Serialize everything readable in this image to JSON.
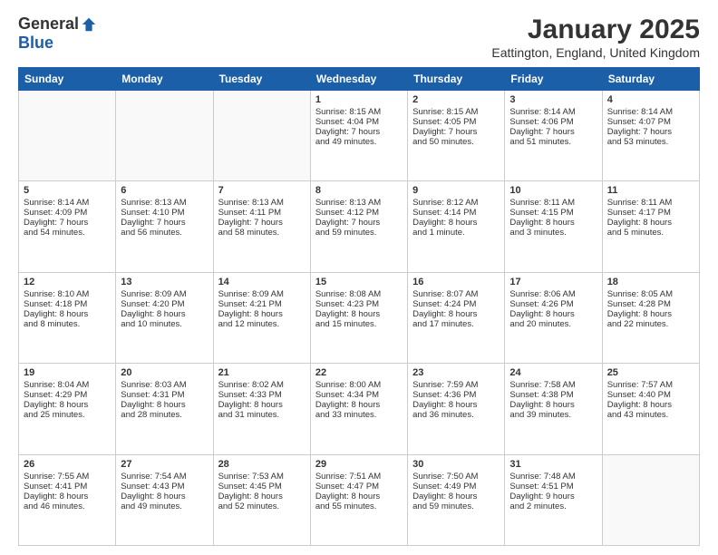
{
  "logo": {
    "general": "General",
    "blue": "Blue"
  },
  "title": "January 2025",
  "subtitle": "Eattington, England, United Kingdom",
  "days": [
    "Sunday",
    "Monday",
    "Tuesday",
    "Wednesday",
    "Thursday",
    "Friday",
    "Saturday"
  ],
  "weeks": [
    [
      {
        "day": "",
        "content": ""
      },
      {
        "day": "",
        "content": ""
      },
      {
        "day": "",
        "content": ""
      },
      {
        "day": "1",
        "content": "Sunrise: 8:15 AM\nSunset: 4:04 PM\nDaylight: 7 hours\nand 49 minutes."
      },
      {
        "day": "2",
        "content": "Sunrise: 8:15 AM\nSunset: 4:05 PM\nDaylight: 7 hours\nand 50 minutes."
      },
      {
        "day": "3",
        "content": "Sunrise: 8:14 AM\nSunset: 4:06 PM\nDaylight: 7 hours\nand 51 minutes."
      },
      {
        "day": "4",
        "content": "Sunrise: 8:14 AM\nSunset: 4:07 PM\nDaylight: 7 hours\nand 53 minutes."
      }
    ],
    [
      {
        "day": "5",
        "content": "Sunrise: 8:14 AM\nSunset: 4:09 PM\nDaylight: 7 hours\nand 54 minutes."
      },
      {
        "day": "6",
        "content": "Sunrise: 8:13 AM\nSunset: 4:10 PM\nDaylight: 7 hours\nand 56 minutes."
      },
      {
        "day": "7",
        "content": "Sunrise: 8:13 AM\nSunset: 4:11 PM\nDaylight: 7 hours\nand 58 minutes."
      },
      {
        "day": "8",
        "content": "Sunrise: 8:13 AM\nSunset: 4:12 PM\nDaylight: 7 hours\nand 59 minutes."
      },
      {
        "day": "9",
        "content": "Sunrise: 8:12 AM\nSunset: 4:14 PM\nDaylight: 8 hours\nand 1 minute."
      },
      {
        "day": "10",
        "content": "Sunrise: 8:11 AM\nSunset: 4:15 PM\nDaylight: 8 hours\nand 3 minutes."
      },
      {
        "day": "11",
        "content": "Sunrise: 8:11 AM\nSunset: 4:17 PM\nDaylight: 8 hours\nand 5 minutes."
      }
    ],
    [
      {
        "day": "12",
        "content": "Sunrise: 8:10 AM\nSunset: 4:18 PM\nDaylight: 8 hours\nand 8 minutes."
      },
      {
        "day": "13",
        "content": "Sunrise: 8:09 AM\nSunset: 4:20 PM\nDaylight: 8 hours\nand 10 minutes."
      },
      {
        "day": "14",
        "content": "Sunrise: 8:09 AM\nSunset: 4:21 PM\nDaylight: 8 hours\nand 12 minutes."
      },
      {
        "day": "15",
        "content": "Sunrise: 8:08 AM\nSunset: 4:23 PM\nDaylight: 8 hours\nand 15 minutes."
      },
      {
        "day": "16",
        "content": "Sunrise: 8:07 AM\nSunset: 4:24 PM\nDaylight: 8 hours\nand 17 minutes."
      },
      {
        "day": "17",
        "content": "Sunrise: 8:06 AM\nSunset: 4:26 PM\nDaylight: 8 hours\nand 20 minutes."
      },
      {
        "day": "18",
        "content": "Sunrise: 8:05 AM\nSunset: 4:28 PM\nDaylight: 8 hours\nand 22 minutes."
      }
    ],
    [
      {
        "day": "19",
        "content": "Sunrise: 8:04 AM\nSunset: 4:29 PM\nDaylight: 8 hours\nand 25 minutes."
      },
      {
        "day": "20",
        "content": "Sunrise: 8:03 AM\nSunset: 4:31 PM\nDaylight: 8 hours\nand 28 minutes."
      },
      {
        "day": "21",
        "content": "Sunrise: 8:02 AM\nSunset: 4:33 PM\nDaylight: 8 hours\nand 31 minutes."
      },
      {
        "day": "22",
        "content": "Sunrise: 8:00 AM\nSunset: 4:34 PM\nDaylight: 8 hours\nand 33 minutes."
      },
      {
        "day": "23",
        "content": "Sunrise: 7:59 AM\nSunset: 4:36 PM\nDaylight: 8 hours\nand 36 minutes."
      },
      {
        "day": "24",
        "content": "Sunrise: 7:58 AM\nSunset: 4:38 PM\nDaylight: 8 hours\nand 39 minutes."
      },
      {
        "day": "25",
        "content": "Sunrise: 7:57 AM\nSunset: 4:40 PM\nDaylight: 8 hours\nand 43 minutes."
      }
    ],
    [
      {
        "day": "26",
        "content": "Sunrise: 7:55 AM\nSunset: 4:41 PM\nDaylight: 8 hours\nand 46 minutes."
      },
      {
        "day": "27",
        "content": "Sunrise: 7:54 AM\nSunset: 4:43 PM\nDaylight: 8 hours\nand 49 minutes."
      },
      {
        "day": "28",
        "content": "Sunrise: 7:53 AM\nSunset: 4:45 PM\nDaylight: 8 hours\nand 52 minutes."
      },
      {
        "day": "29",
        "content": "Sunrise: 7:51 AM\nSunset: 4:47 PM\nDaylight: 8 hours\nand 55 minutes."
      },
      {
        "day": "30",
        "content": "Sunrise: 7:50 AM\nSunset: 4:49 PM\nDaylight: 8 hours\nand 59 minutes."
      },
      {
        "day": "31",
        "content": "Sunrise: 7:48 AM\nSunset: 4:51 PM\nDaylight: 9 hours\nand 2 minutes."
      },
      {
        "day": "",
        "content": ""
      }
    ]
  ]
}
